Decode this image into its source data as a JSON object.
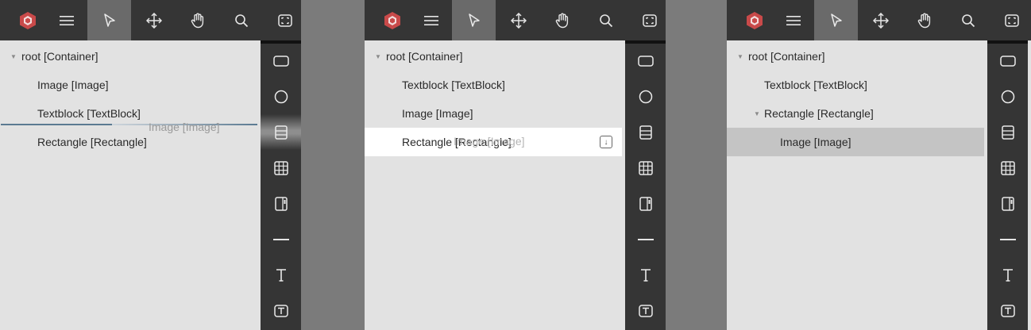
{
  "colors": {
    "toolbar_bg": "#353535",
    "active_tool_bg": "#6a6a6a",
    "tree_bg": "#e2e2e2",
    "logo_red": "#c94a4a",
    "selected_row": "#c4c4c4",
    "drop_line": "#5b7a92"
  },
  "toolbar": {
    "items": [
      {
        "name": "logo",
        "icon": "hexagon-logo-icon"
      },
      {
        "name": "menu",
        "icon": "hamburger-menu-icon"
      },
      {
        "name": "select",
        "icon": "pointer-icon",
        "active": true
      },
      {
        "name": "move",
        "icon": "move-arrows-icon"
      },
      {
        "name": "pan",
        "icon": "hand-icon"
      },
      {
        "name": "zoom",
        "icon": "search-icon"
      },
      {
        "name": "fit",
        "icon": "fit-screen-icon"
      }
    ]
  },
  "sidebar": {
    "items": [
      {
        "name": "rectangle",
        "icon": "rectangle-icon"
      },
      {
        "name": "ellipse",
        "icon": "circle-icon"
      },
      {
        "name": "stack",
        "icon": "stack-panel-icon"
      },
      {
        "name": "grid",
        "icon": "grid-icon"
      },
      {
        "name": "scroll",
        "icon": "scrollviewer-icon"
      },
      {
        "name": "line",
        "icon": "line-icon"
      },
      {
        "name": "text",
        "icon": "text-icon"
      },
      {
        "name": "textbox",
        "icon": "textbox-icon"
      }
    ]
  },
  "panels": [
    {
      "rows": [
        "root [Container]",
        "Image [Image]",
        "Textblock [TextBlock]",
        "Rectangle [Rectangle]"
      ],
      "ghost_label": "Image [Image]"
    },
    {
      "rows": [
        "root [Container]",
        "Textblock [TextBlock]",
        "Image [Image]",
        "Rectangle [Rectangle]"
      ],
      "ghost_label": "Image [Image]"
    },
    {
      "rows": [
        "root [Container]",
        "Textblock [TextBlock]",
        "Rectangle [Rectangle]",
        "Image [Image]"
      ]
    }
  ]
}
